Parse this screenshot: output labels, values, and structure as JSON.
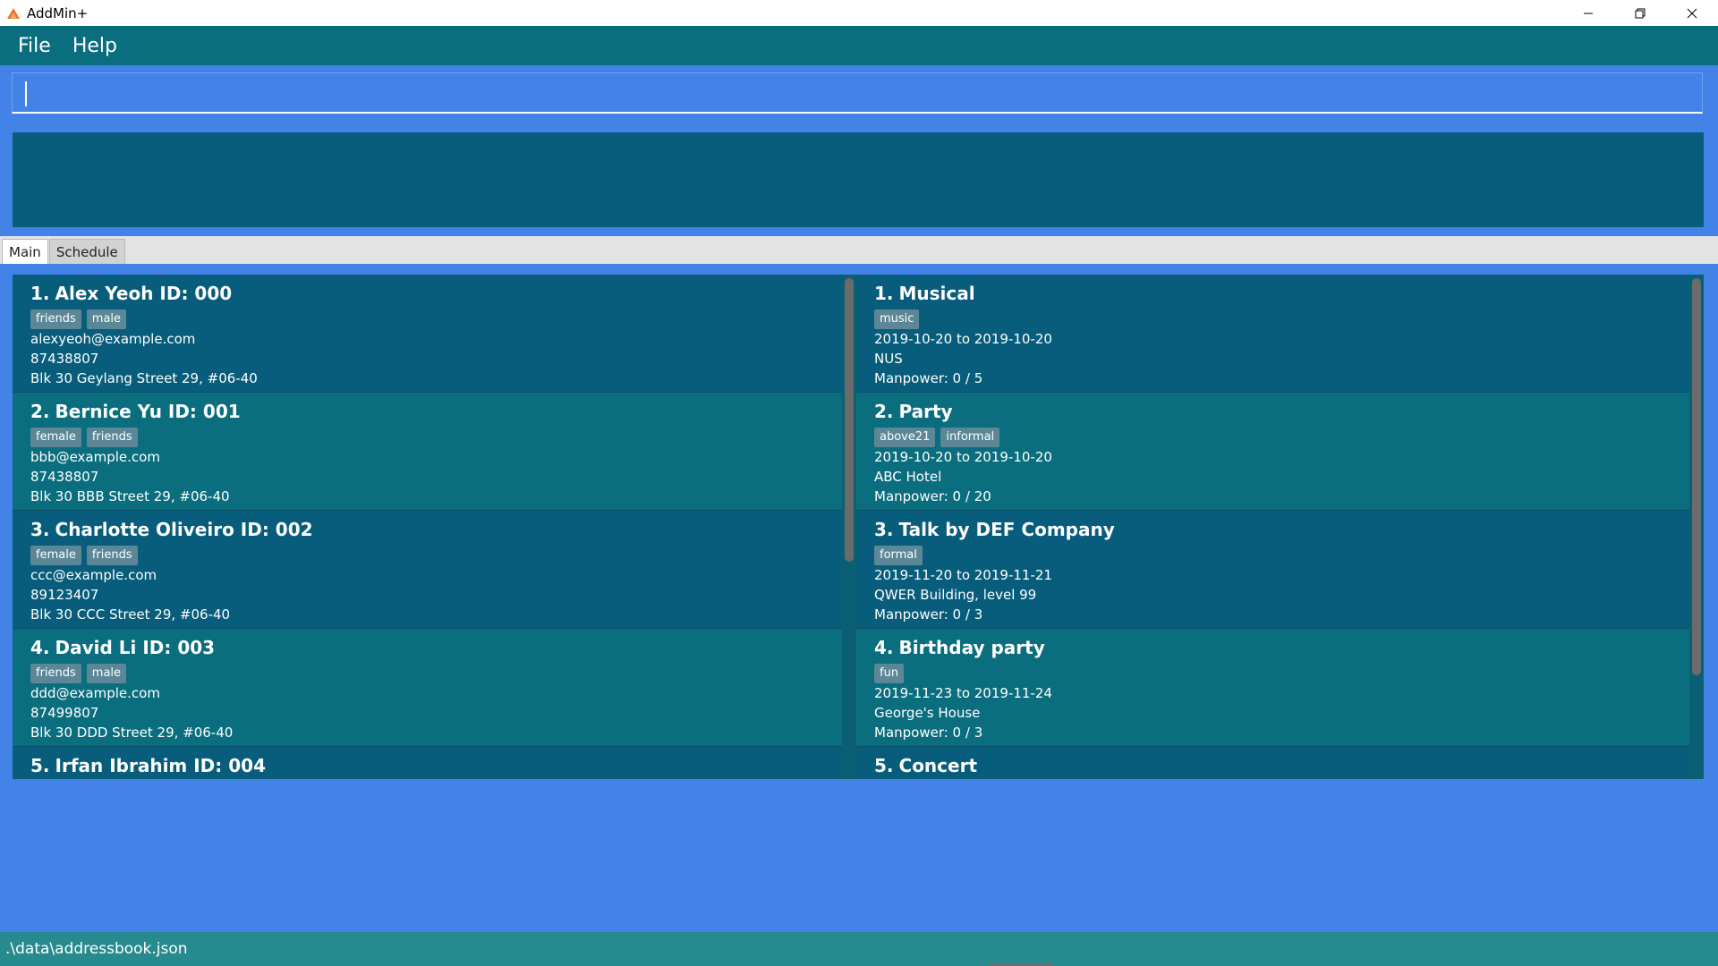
{
  "window": {
    "title": "AddMin+",
    "icon": "java-icon",
    "controls": [
      "minimize",
      "restore",
      "close"
    ]
  },
  "menu": {
    "file": "File",
    "help": "Help"
  },
  "command": {
    "value": "",
    "placeholder": ""
  },
  "result": {
    "text": ""
  },
  "tabs": {
    "main": "Main",
    "schedule": "Schedule",
    "active": "Main"
  },
  "persons": [
    {
      "index": "1.",
      "name": "Alex Yeoh ID: 000",
      "tags": [
        "friends",
        "male"
      ],
      "email": "alexyeoh@example.com",
      "phone": "87438807",
      "address": "Blk 30 Geylang Street 29, #06-40"
    },
    {
      "index": "2.",
      "name": "Bernice Yu ID: 001",
      "tags": [
        "female",
        "friends"
      ],
      "email": "bbb@example.com",
      "phone": "87438807",
      "address": "Blk 30 BBB Street 29, #06-40"
    },
    {
      "index": "3.",
      "name": "Charlotte Oliveiro ID: 002",
      "tags": [
        "female",
        "friends"
      ],
      "email": "ccc@example.com",
      "phone": "89123407",
      "address": "Blk 30 CCC Street 29, #06-40"
    },
    {
      "index": "4.",
      "name": "David Li ID: 003",
      "tags": [
        "friends",
        "male"
      ],
      "email": "ddd@example.com",
      "phone": "87499807",
      "address": "Blk 30 DDD Street 29, #06-40"
    },
    {
      "index": "5.",
      "name": "Irfan Ibrahim ID: 004"
    }
  ],
  "events": [
    {
      "index": "1.",
      "name": "Musical",
      "tags": [
        "music"
      ],
      "dates": "2019-10-20 to 2019-10-20",
      "venue": "NUS",
      "manpower": "Manpower: 0 / 5"
    },
    {
      "index": "2.",
      "name": "Party",
      "tags": [
        "above21",
        "informal"
      ],
      "dates": "2019-10-20 to 2019-10-20",
      "venue": "ABC Hotel",
      "manpower": "Manpower: 0 / 20"
    },
    {
      "index": "3.",
      "name": "Talk by DEF Company",
      "tags": [
        "formal"
      ],
      "dates": "2019-11-20 to 2019-11-21",
      "venue": "QWER Building, level 99",
      "manpower": "Manpower: 0 / 3"
    },
    {
      "index": "4.",
      "name": "Birthday party",
      "tags": [
        "fun"
      ],
      "dates": "2019-11-23 to 2019-11-24",
      "venue": "George's House",
      "manpower": "Manpower: 0 / 3"
    },
    {
      "index": "5.",
      "name": "Concert"
    }
  ],
  "status": {
    "path": ".\\data\\addressbook.json"
  },
  "colors": {
    "background": "#4383e8",
    "menubar": "#0b6e7e",
    "card_dark": "#075d7b",
    "card_light": "#0b6e7e",
    "tag": "#5b8797",
    "statusbar": "#268a8f"
  }
}
